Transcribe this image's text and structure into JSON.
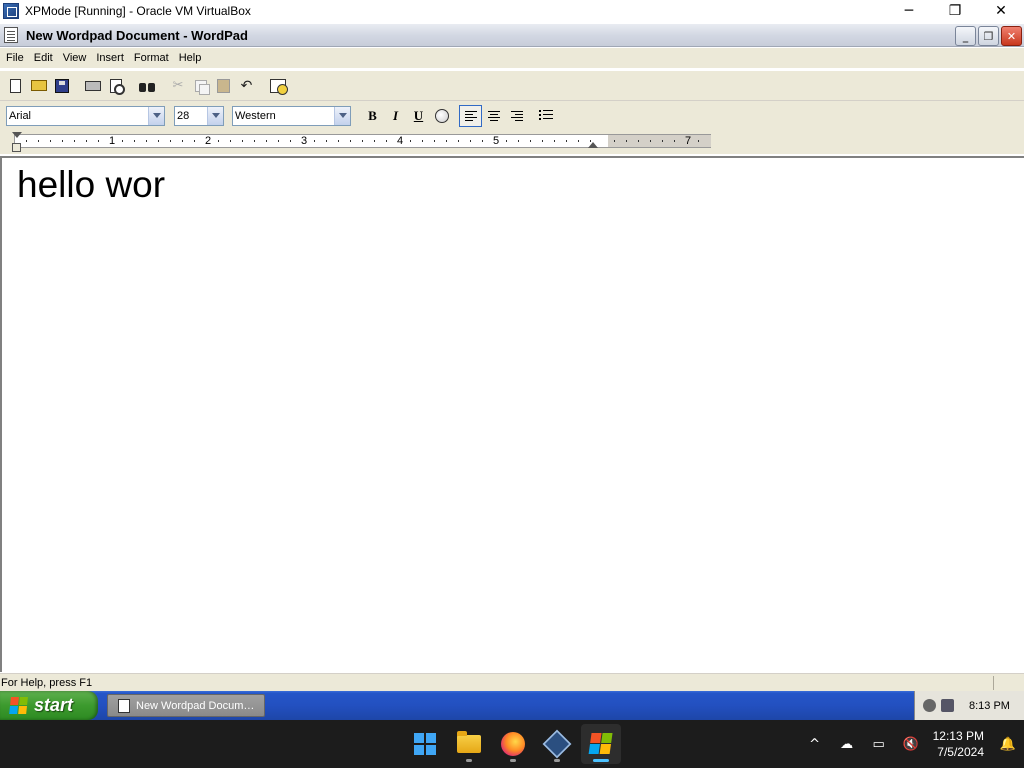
{
  "host_window": {
    "title": "XPMode [Running] - Oracle VM VirtualBox",
    "controls": {
      "minimize": "─",
      "maximize": "❐",
      "close": "✕"
    }
  },
  "wordpad": {
    "title": "New Wordpad Document - WordPad",
    "controls": {
      "minimize": "_",
      "restore": "❐",
      "close": "✕"
    },
    "menu": [
      "File",
      "Edit",
      "View",
      "Insert",
      "Format",
      "Help"
    ],
    "toolbar_icons": [
      "new-icon",
      "open-icon",
      "save-icon",
      "print-icon",
      "print-preview-icon",
      "find-icon",
      "cut-icon",
      "copy-icon",
      "paste-icon",
      "undo-icon",
      "date-time-icon"
    ],
    "format_bar": {
      "font": "Arial",
      "size": "28",
      "script": "Western",
      "bold": "B",
      "italic": "I",
      "underline": "U",
      "alignment_active": "left"
    },
    "ruler": {
      "numbers": [
        "1",
        "2",
        "3",
        "4",
        "5",
        "7"
      ]
    },
    "document_text": "hello wor",
    "status": "For Help, press F1"
  },
  "xp_taskbar": {
    "start_label": "start",
    "task_label": "New Wordpad Docum…",
    "clock": "8:13 PM"
  },
  "win11_taskbar": {
    "pinned": [
      "windows-start-icon",
      "file-explorer-icon",
      "firefox-icon",
      "virtualbox-icon",
      "xp-mode-icon"
    ],
    "clock_time": "12:13 PM",
    "clock_date": "7/5/2024",
    "tray_chevron": "^",
    "colors": {
      "accent": "#4cc2ff",
      "background": "#1c1c1c"
    }
  }
}
